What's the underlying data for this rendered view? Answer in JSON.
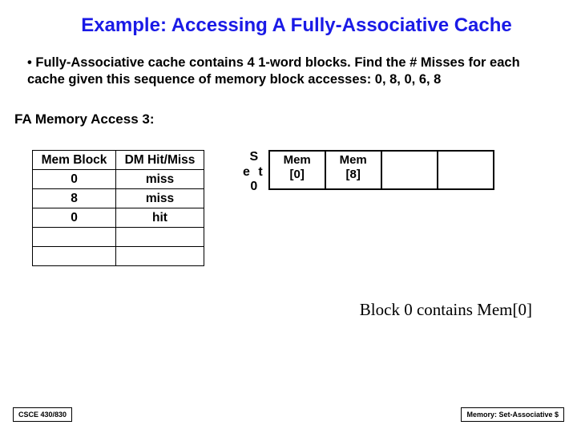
{
  "title": "Example: Accessing A Fully-Associative Cache",
  "bullet": "Fully-Associative cache contains 4 1-word blocks. Find the # Misses for each cache given this sequence of memory block accesses: 0, 8, 0, 6, 8",
  "subheading": "FA Memory Access 3:",
  "access_table": {
    "head": {
      "mb": "Mem Block",
      "hm": "DM Hit/Miss"
    },
    "rows": [
      {
        "mb": "0",
        "hm": "miss"
      },
      {
        "mb": "8",
        "hm": "miss"
      },
      {
        "mb": "0",
        "hm": "hit"
      },
      {
        "mb": "",
        "hm": ""
      },
      {
        "mb": "",
        "hm": ""
      }
    ]
  },
  "set": {
    "label_col": {
      "l1": "S",
      "l2": "e t",
      "l3": "0"
    },
    "cells": [
      "Mem\n[0]",
      "Mem\n[8]",
      "",
      ""
    ]
  },
  "caption": "Block 0 contains Mem[0]",
  "footer": {
    "left": "CSCE 430/830",
    "right": "Memory: Set-Associative $"
  },
  "chart_data": {
    "type": "table",
    "title": "FA Memory Access 3",
    "columns": [
      "Mem Block",
      "DM Hit/Miss"
    ],
    "rows": [
      [
        "0",
        "miss"
      ],
      [
        "8",
        "miss"
      ],
      [
        "0",
        "hit"
      ]
    ],
    "cache_set": {
      "set": 0,
      "blocks": [
        "Mem[0]",
        "Mem[8]",
        null,
        null
      ]
    }
  }
}
